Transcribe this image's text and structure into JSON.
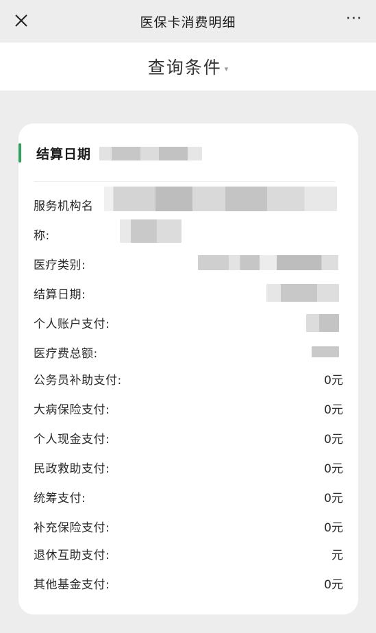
{
  "navbar": {
    "title": "医保卡消费明细",
    "more": "···"
  },
  "query": {
    "label": "查询条件",
    "caret": "▾"
  },
  "card": {
    "title": "结算日期",
    "accent_color": "#2ea15a",
    "rows": [
      {
        "label": "服务机构名",
        "value": ""
      },
      {
        "label": "称:",
        "value": ""
      },
      {
        "label": "医疗类别:",
        "value": ""
      },
      {
        "label": "结算日期:",
        "value": ""
      },
      {
        "label": "个人账户支付:",
        "value": ""
      },
      {
        "label": "医疗费总额:",
        "value": ""
      },
      {
        "label": "公务员补助支付:",
        "value": "0元"
      },
      {
        "label": "大病保险支付:",
        "value": "0元"
      },
      {
        "label": "个人现金支付:",
        "value": "0元"
      },
      {
        "label": "民政救助支付:",
        "value": "0元"
      },
      {
        "label": "统筹支付:",
        "value": "0元"
      },
      {
        "label": "补充保险支付:",
        "value": "0元"
      },
      {
        "label": "退休互助支付:",
        "value": "元"
      },
      {
        "label": "其他基金支付:",
        "value": "0元"
      }
    ]
  }
}
